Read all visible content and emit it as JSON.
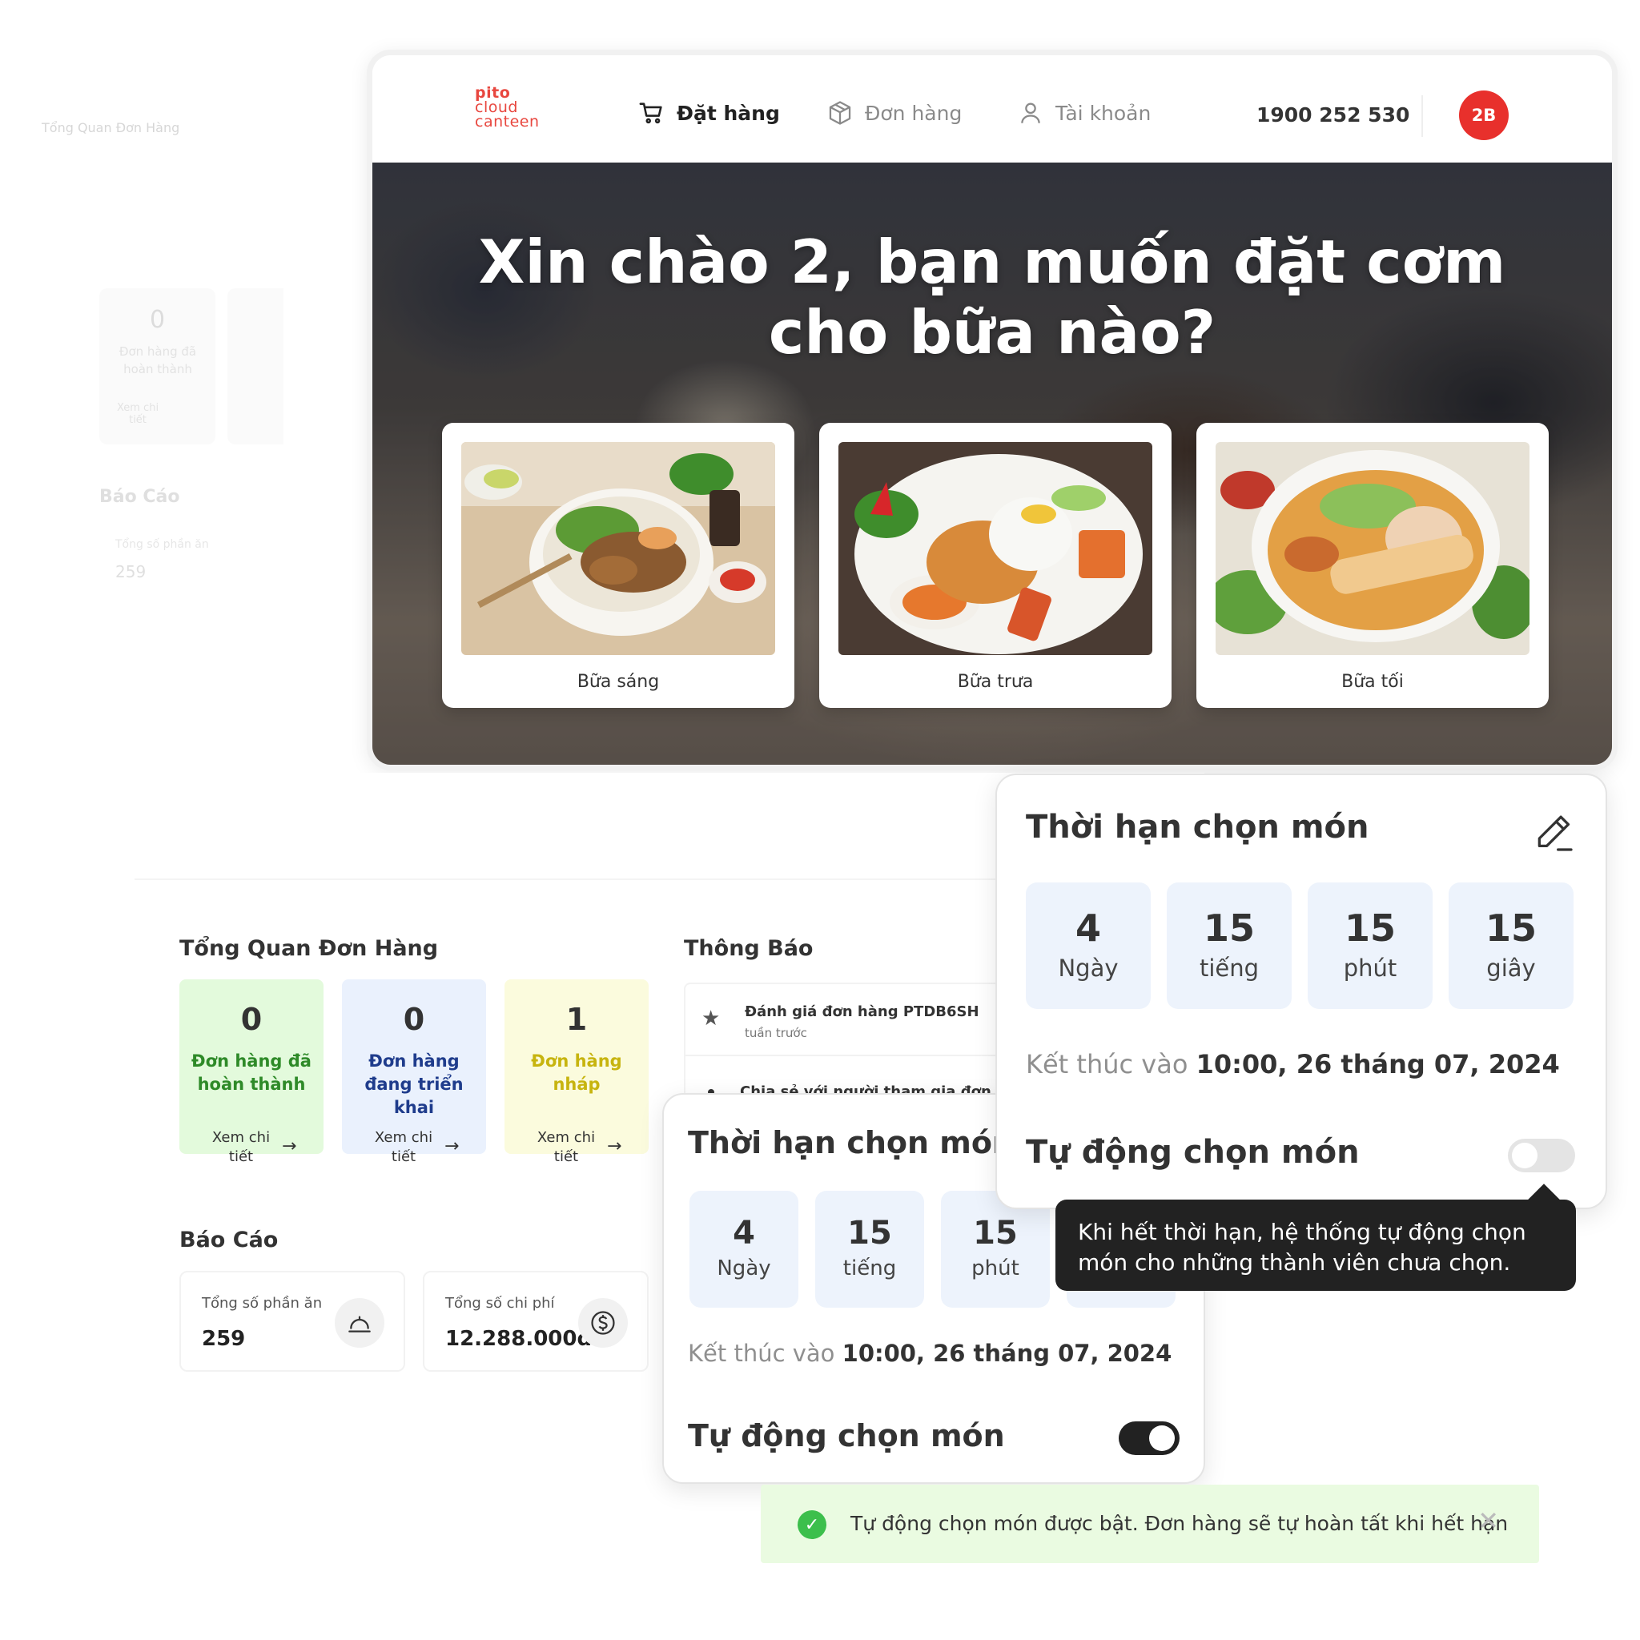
{
  "ghost": {
    "title": "Tổng Quan Đơn Hàng",
    "card_value": "0",
    "card_label": "Đơn hàng đã hoàn thành",
    "card_link": "Xem chi tiết",
    "report_title": "Báo Cáo",
    "report_label": "Tổng số phần ăn",
    "report_value": "259"
  },
  "logo": {
    "line1": "pito",
    "line2": "cloud",
    "line3": "canteen"
  },
  "nav": {
    "items": [
      {
        "label": "Đặt hàng",
        "icon": "cart-icon",
        "active": true
      },
      {
        "label": "Đơn hàng",
        "icon": "box-icon",
        "active": false
      },
      {
        "label": "Tài khoản",
        "icon": "user-icon",
        "active": false
      }
    ],
    "phone": "1900 252 530",
    "avatar": "2B"
  },
  "hero": {
    "title": "Xin chào 2, bạn muốn đặt cơm cho bữa nào?",
    "meals": [
      {
        "label": "Bữa sáng"
      },
      {
        "label": "Bữa trưa"
      },
      {
        "label": "Bữa tối"
      }
    ]
  },
  "overview": {
    "title": "Tổng Quan Đơn Hàng",
    "stats": [
      {
        "value": "0",
        "label": "Đơn hàng đã hoàn thành",
        "link": "Xem chi tiết",
        "color": "#2e8a28"
      },
      {
        "value": "0",
        "label": "Đơn hàng đang triển khai",
        "link": "Xem chi tiết",
        "color": "#1f3c8c"
      },
      {
        "value": "1",
        "label": "Đơn hàng nháp",
        "link": "Xem chi tiết",
        "color": "#c7b40f"
      }
    ]
  },
  "report": {
    "title": "Báo Cáo",
    "cards": [
      {
        "label": "Tổng số phần ăn",
        "value": "259",
        "icon": "cloche-icon"
      },
      {
        "label": "Tổng số chi phí",
        "value": "12.288.000đ",
        "icon": "dollar-icon"
      }
    ]
  },
  "notifications": {
    "title": "Thông Báo",
    "items": [
      {
        "title": "Đánh giá đơn hàng PTDB6SH",
        "time": "tuần trước",
        "icon": "star-icon"
      },
      {
        "title": "Chia sẻ với người tham gia đơn hàng"
      }
    ]
  },
  "deadline_panel_top": {
    "title": "Thời hạn chọn món",
    "countdown": [
      {
        "value": "4",
        "unit": "Ngày"
      },
      {
        "value": "15",
        "unit": "tiếng"
      },
      {
        "value": "15",
        "unit": "phút"
      },
      {
        "value": "15",
        "unit": "giây"
      }
    ],
    "end_prefix": "Kết thúc vào",
    "end_value": "10:00, 26 tháng 07, 2024",
    "auto_label": "Tự động chọn món",
    "auto_enabled": false
  },
  "deadline_panel_bottom": {
    "title": "Thời hạn chọn món",
    "countdown": [
      {
        "value": "4",
        "unit": "Ngày"
      },
      {
        "value": "15",
        "unit": "tiếng"
      },
      {
        "value": "15",
        "unit": "phút"
      }
    ],
    "end_prefix": "Kết thúc vào",
    "end_value": "10:00, 26 tháng 07, 2024",
    "auto_label": "Tự động chọn món",
    "auto_enabled": true
  },
  "tooltip": {
    "text": "Khi hết thời hạn, hệ thống tự động chọn món cho những thành viên chưa chọn."
  },
  "toast": {
    "message": "Tự động chọn món được bật. Đơn hàng sẽ tự hoàn tất khi hết hạn",
    "icon": "check-circle-icon"
  },
  "colors": {
    "brand_red": "#e8302c",
    "tooltip_bg": "#222222",
    "toast_bg": "#eafbe1",
    "countdown_bg": "#edf3fc"
  }
}
